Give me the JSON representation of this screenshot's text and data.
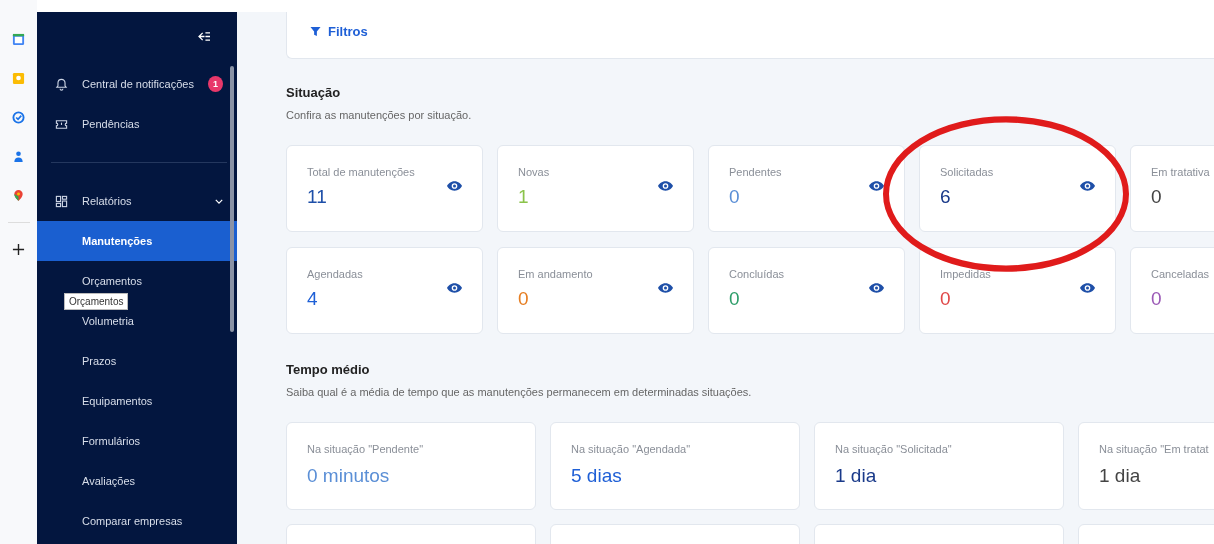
{
  "sidebar": {
    "top_items": [
      {
        "label": "Central de notificações",
        "badge": "1"
      },
      {
        "label": "Pendências"
      }
    ],
    "group": {
      "label": "Relatórios",
      "expanded": true,
      "children": [
        {
          "label": "Manutenções",
          "selected": true
        },
        {
          "label": "Orçamentos",
          "selected": false
        },
        {
          "label": "Volumetria",
          "selected": false
        },
        {
          "label": "Prazos",
          "selected": false
        },
        {
          "label": "Equipamentos",
          "selected": false
        },
        {
          "label": "Formulários",
          "selected": false
        },
        {
          "label": "Avaliações",
          "selected": false
        },
        {
          "label": "Comparar empresas",
          "selected": false
        }
      ]
    },
    "tooltip": "Orçamentos"
  },
  "filters": {
    "label": "Filtros"
  },
  "situation": {
    "title": "Situação",
    "subtitle": "Confira as manutenções por situação.",
    "cards": [
      {
        "label": "Total de manutenções",
        "value": "11",
        "color": "#1e4fa8"
      },
      {
        "label": "Novas",
        "value": "1",
        "color": "#8bc34a"
      },
      {
        "label": "Pendentes",
        "value": "0",
        "color": "#5b8fd6"
      },
      {
        "label": "Solicitadas",
        "value": "6",
        "color": "#1a3a8a"
      },
      {
        "label": "Em tratativa",
        "value": "0",
        "color": "#444444"
      },
      {
        "label": "Agendadas",
        "value": "4",
        "color": "#1e5fd6"
      },
      {
        "label": "Em andamento",
        "value": "0",
        "color": "#e67e22"
      },
      {
        "label": "Concluídas",
        "value": "0",
        "color": "#2e9e6a"
      },
      {
        "label": "Impedidas",
        "value": "0",
        "color": "#e04848"
      },
      {
        "label": "Canceladas",
        "value": "0",
        "color": "#9b59b6"
      }
    ]
  },
  "average_time": {
    "title": "Tempo médio",
    "subtitle": "Saiba qual é a média de tempo que as manutenções permanecem em determinadas situações.",
    "cards": [
      {
        "label": "Na situação \"Pendente\"",
        "value": "0 minutos",
        "color": "#5b8fd6"
      },
      {
        "label": "Na situação \"Agendada\"",
        "value": "5 dias",
        "color": "#1e5fd6"
      },
      {
        "label": "Na situação \"Solicitada\"",
        "value": "1 dia",
        "color": "#1a3a8a"
      },
      {
        "label": "Na situação \"Em tratat",
        "value": "1 dia",
        "color": "#444444"
      }
    ]
  }
}
